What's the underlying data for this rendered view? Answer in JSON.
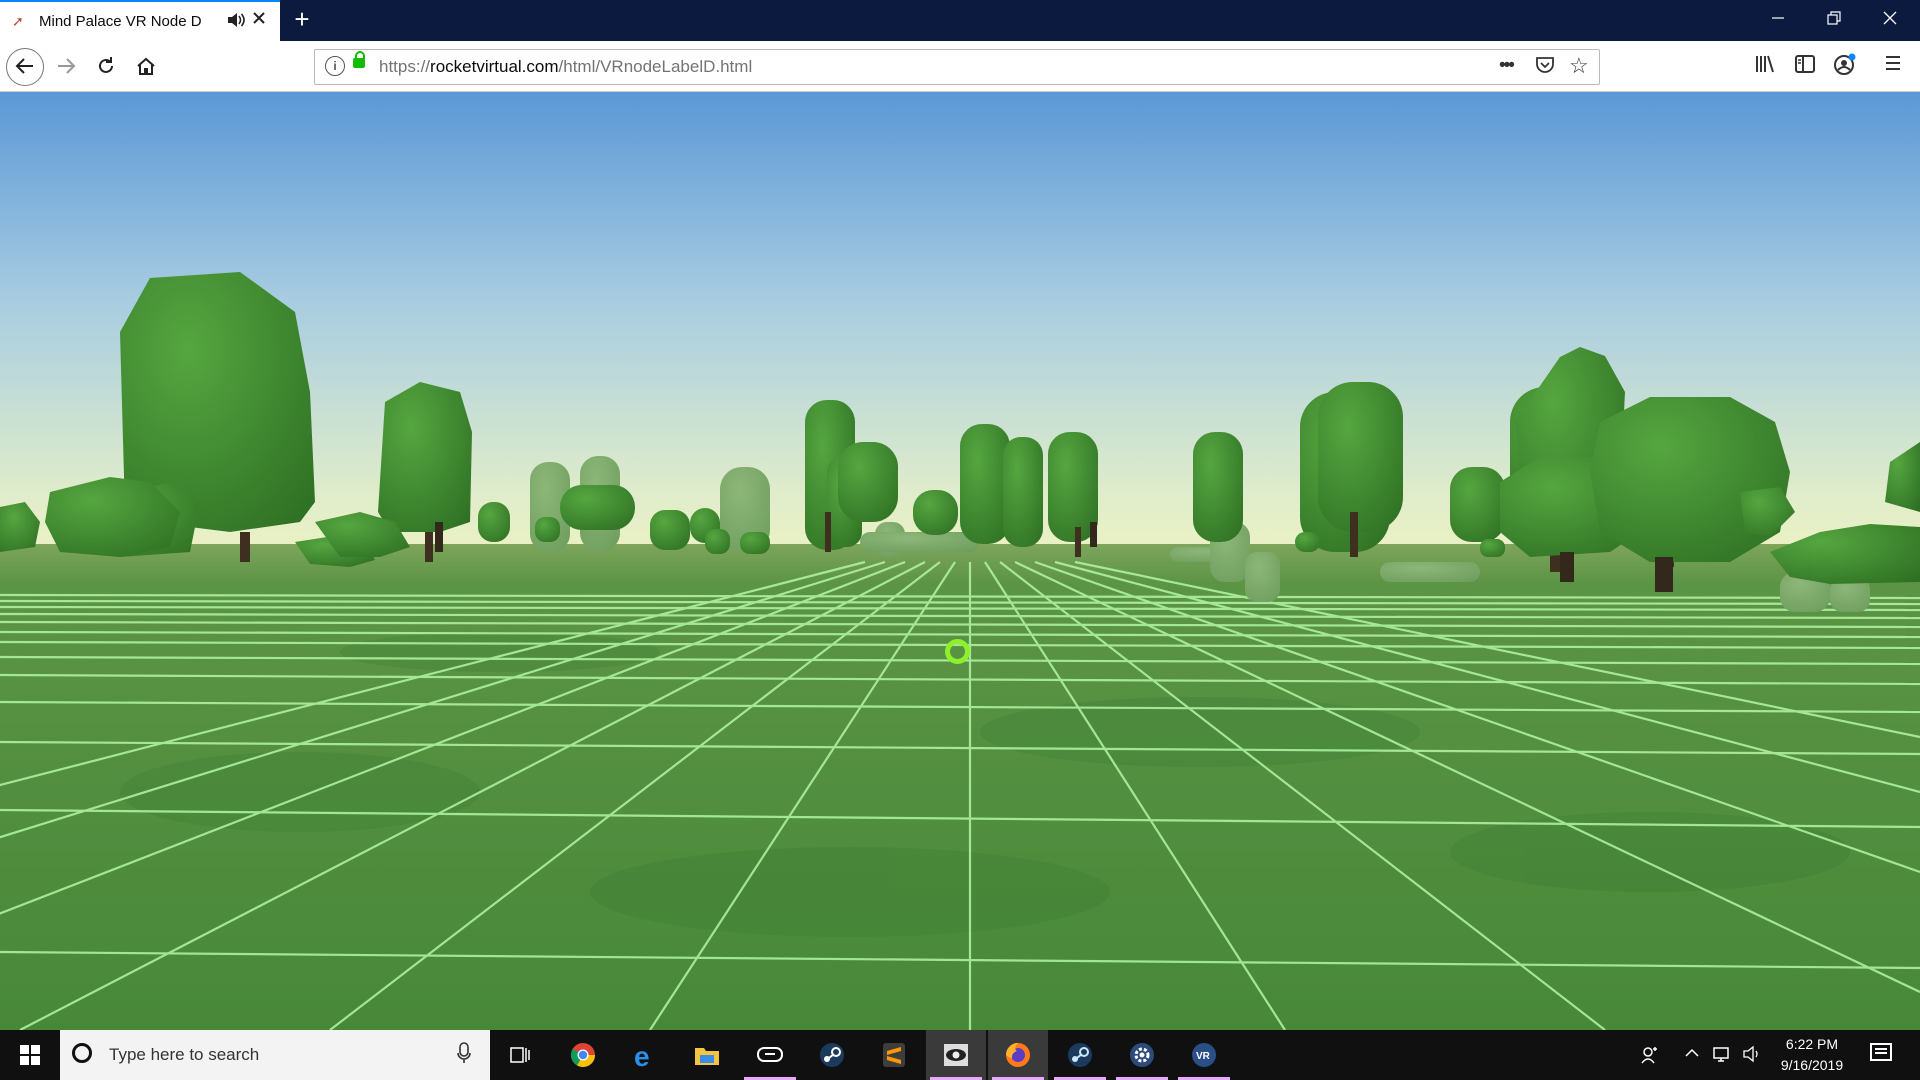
{
  "browser": {
    "tab": {
      "title": "Mind Palace VR Node D",
      "favicon": "rocket-icon",
      "audio_icon": "speaker-icon",
      "close_icon": "close-icon"
    },
    "new_tab_symbol": "+",
    "window_controls": {
      "minimize": "—",
      "restore": "❐",
      "close": "✕"
    },
    "nav": {
      "back": "←",
      "forward": "→",
      "reload": "↻",
      "home": "⌂"
    },
    "url": {
      "prefix": "https://",
      "domain": "rocketvirtual.com",
      "path": "/html/VRnodeLabelD.html",
      "secure": true
    },
    "url_actions": {
      "page_actions": "•••",
      "pocket": "pocket-icon",
      "bookmark": "☆"
    },
    "toolbar_icons": [
      "library-icon",
      "sidebar-icon",
      "account-icon",
      "menu-icon"
    ]
  },
  "scene": {
    "description_colors": {
      "sky_top": "#5b98d6",
      "sky_horizon": "#e9f0c0",
      "ground": "#4a8a3c",
      "grid": "#a9f5a0",
      "tree": "#3e8a2e"
    },
    "reticle_color": "#8ef02a",
    "vr_button_icon": "vr-headset-icon"
  },
  "taskbar": {
    "search_placeholder": "Type here to search",
    "apps": [
      "task-view-icon",
      "chrome-icon",
      "edge-icon",
      "file-explorer-icon",
      "vr-headset-app-icon",
      "steam-icon",
      "sublime-text-icon",
      "eye-app-icon",
      "firefox-icon",
      "steam-vr-icon",
      "settings-gear-icon",
      "vr-app-icon"
    ],
    "clock": {
      "time": "6:22 PM",
      "date": "9/16/2019"
    }
  }
}
